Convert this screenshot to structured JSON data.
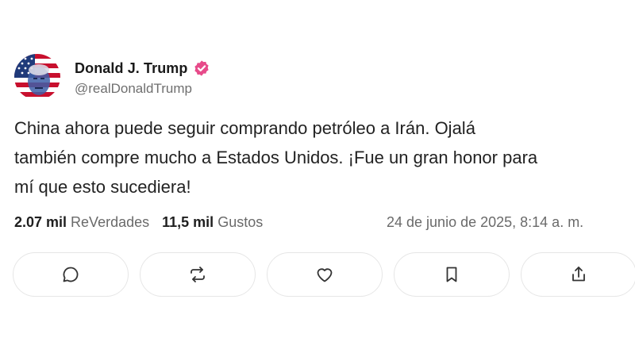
{
  "author": {
    "display_name": "Donald J. Trump",
    "handle": "@realDonaldTrump",
    "verified_color": "#e74b8a"
  },
  "post": {
    "text_lines": [
      "China ahora puede seguir comprando petróleo a Irán. Ojalá",
      "también compre mucho a Estados Unidos. ¡Fue un gran honor para",
      "mí que esto sucediera!"
    ]
  },
  "stats": {
    "reposts_count": "2.07 mil",
    "reposts_label": "ReVerdades",
    "likes_count": "11,5 mil",
    "likes_label": "Gustos",
    "timestamp": "24 de junio de 2025, 8:14 a. m."
  },
  "actions": [
    {
      "icon": "reply-icon"
    },
    {
      "icon": "repost-icon"
    },
    {
      "icon": "heart-icon"
    },
    {
      "icon": "bookmark-icon"
    },
    {
      "icon": "share-icon"
    }
  ]
}
